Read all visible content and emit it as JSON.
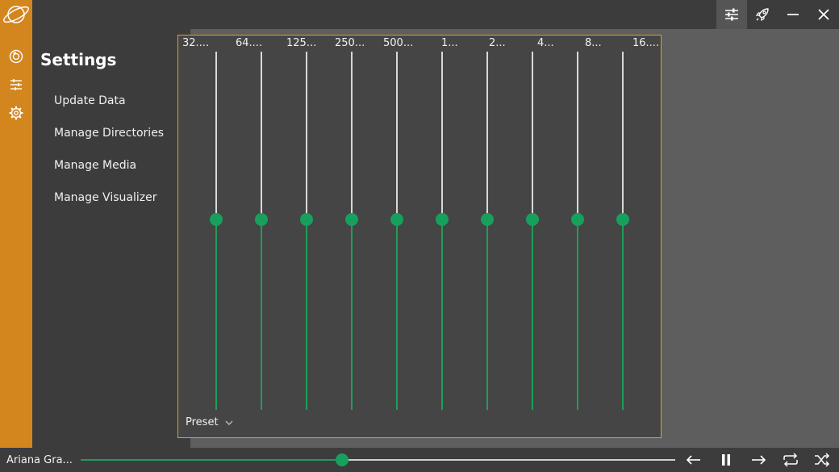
{
  "settings": {
    "title": "Settings",
    "items": [
      "Update Data",
      "Manage Directories",
      "Manage Media",
      "Manage Visualizer"
    ]
  },
  "equalizer": {
    "bands": [
      {
        "label": "32....",
        "level": 0.5
      },
      {
        "label": "64....",
        "level": 0.5
      },
      {
        "label": "125...",
        "level": 0.5
      },
      {
        "label": "250...",
        "level": 0.5
      },
      {
        "label": "500...",
        "level": 0.5
      },
      {
        "label": "1...",
        "level": 0.5
      },
      {
        "label": "2...",
        "level": 0.5
      },
      {
        "label": "4...",
        "level": 0.5
      },
      {
        "label": "8...",
        "level": 0.5
      },
      {
        "label": "16....",
        "level": 0.5
      }
    ],
    "preset_label": "Preset"
  },
  "player": {
    "track_title": "Ariana Gra...",
    "progress": 0.44
  },
  "colors": {
    "accent": "#d4861e",
    "slider_green": "#16a05c",
    "panel_border": "#e0a020"
  },
  "icons": {
    "logo": "planet-icon",
    "sidebar": [
      "disc-icon",
      "equalizer-icon",
      "gear-icon"
    ],
    "window": [
      "sliders-icon",
      "rocket-icon",
      "minimize-icon",
      "close-icon"
    ],
    "player": [
      "previous-icon",
      "pause-icon",
      "next-icon",
      "repeat-icon",
      "shuffle-icon"
    ]
  }
}
